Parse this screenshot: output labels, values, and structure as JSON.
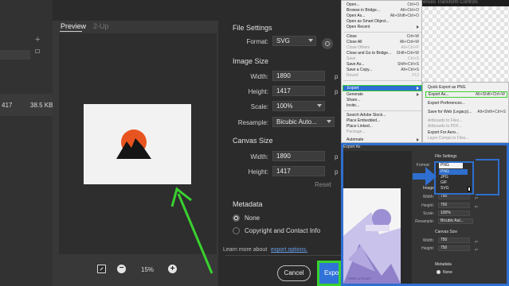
{
  "left": {
    "dim_value": "417",
    "file_size": "38.5 KB",
    "plus": "+"
  },
  "preview": {
    "tabs": [
      "Preview",
      "2-Up"
    ],
    "zoom": "15%",
    "zoom_in": "+",
    "zoom_out": "−"
  },
  "settings": {
    "file_settings_title": "File Settings",
    "format_label": "Format:",
    "format_value": "SVG",
    "image_size_title": "Image Size",
    "width_label": "Width:",
    "width_value": "1890",
    "height_label": "Height:",
    "height_value": "1417",
    "scale_label": "Scale:",
    "scale_value": "100%",
    "resample_label": "Resample:",
    "resample_value": "Bicubic Auto...",
    "unit": "p",
    "canvas_size_title": "Canvas Size",
    "canvas_width_value": "1890",
    "canvas_height_value": "1417",
    "reset_label": "Reset",
    "metadata_title": "Metadata",
    "metadata_none": "None",
    "metadata_copyright": "Copyright and Contact Info",
    "learn_more": "Learn more about",
    "learn_more_link": "export options.",
    "cancel_label": "Cancel",
    "export_label": "Expo"
  },
  "topbar": {
    "tabs_text": "ences   Transform Controls"
  },
  "file_menu": {
    "items": [
      {
        "label": "Open...",
        "shortcut": "Ctrl+O",
        "disabled": false
      },
      {
        "label": "Browse in Bridge...",
        "shortcut": "Alt+Ctrl+O",
        "disabled": false
      },
      {
        "label": "Open As...",
        "shortcut": "Alt+Shift+Ctrl+O",
        "disabled": false
      },
      {
        "label": "Open as Smart Object...",
        "shortcut": "",
        "disabled": false
      },
      {
        "label": "Open Recent",
        "shortcut": "",
        "disabled": false
      },
      {
        "label": "Close",
        "shortcut": "Ctrl+W",
        "disabled": false
      },
      {
        "label": "Close All",
        "shortcut": "Alt+Ctrl+W",
        "disabled": false
      },
      {
        "label": "Close Others",
        "shortcut": "Alt+Ctrl+P",
        "disabled": true
      },
      {
        "label": "Close and Go to Bridge...",
        "shortcut": "Shift+Ctrl+W",
        "disabled": false
      },
      {
        "label": "Save",
        "shortcut": "Ctrl+S",
        "disabled": true
      },
      {
        "label": "Save As...",
        "shortcut": "Shift+Ctrl+S",
        "disabled": false
      },
      {
        "label": "Save a Copy...",
        "shortcut": "Alt+Ctrl+S",
        "disabled": false
      },
      {
        "label": "Revert",
        "shortcut": "F12",
        "disabled": true
      },
      {
        "label": "Export",
        "shortcut": "",
        "disabled": false
      },
      {
        "label": "Generate",
        "shortcut": "",
        "disabled": false
      },
      {
        "label": "Share...",
        "shortcut": "",
        "disabled": false
      },
      {
        "label": "Invite...",
        "shortcut": "",
        "disabled": false
      },
      {
        "label": "Search Adobe Stock...",
        "shortcut": "",
        "disabled": false
      },
      {
        "label": "Place Embedded...",
        "shortcut": "",
        "disabled": false
      },
      {
        "label": "Place Linked...",
        "shortcut": "",
        "disabled": false
      },
      {
        "label": "Package...",
        "shortcut": "",
        "disabled": true
      },
      {
        "label": "Automate",
        "shortcut": "",
        "disabled": false
      }
    ]
  },
  "export_submenu": {
    "items": [
      {
        "label": "Quick Export as PNG",
        "shortcut": "",
        "disabled": false
      },
      {
        "label": "Export As...",
        "shortcut": "Alt+Shift+Ctrl+W",
        "disabled": false
      },
      {
        "label": "Export Preferences...",
        "shortcut": "",
        "disabled": false
      },
      {
        "label": "Save for Web (Legacy)...",
        "shortcut": "Alt+Shift+Ctrl+S",
        "disabled": false
      },
      {
        "label": "Artboards to Files...",
        "shortcut": "",
        "disabled": true
      },
      {
        "label": "Artboards to PDF...",
        "shortcut": "",
        "disabled": true
      },
      {
        "label": "Export For Aero...",
        "shortcut": "",
        "disabled": false
      },
      {
        "label": "Layer Comps to Files...",
        "shortcut": "",
        "disabled": true
      }
    ]
  },
  "inset": {
    "title": "Export As",
    "file_settings": "File Settings",
    "format_label": "Format:",
    "format_value": "PNG",
    "options": [
      "PNG",
      "JPG",
      "GIF",
      "SVG"
    ],
    "image_size": "Image Size",
    "width_label": "Width:",
    "width_value": "750",
    "height_label": "Height:",
    "height_value": "750",
    "scale_label": "Scale:",
    "scale_value": "100%",
    "resample_label": "Resample:",
    "resample_value": "Bicubic Aut...",
    "canvas_size": "Canvas Size",
    "canvas_width_value": "750",
    "canvas_height_value": "750",
    "unit": "px",
    "metadata": "Metadata",
    "metadata_none": "None",
    "watermark": "TEMPLATE.NET"
  },
  "colors": {
    "accent_blue": "#2e6fd0",
    "highlight_green": "#39d12e",
    "logo_sun": "#e8541f"
  }
}
